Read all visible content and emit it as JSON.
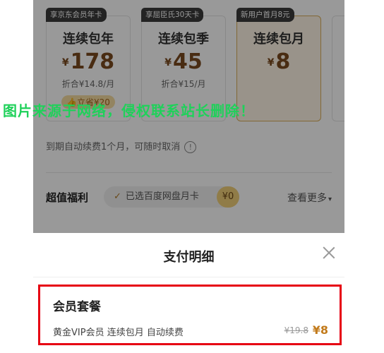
{
  "plans": [
    {
      "tag": "享京东会员年卡",
      "name": "连续包年",
      "currency": "¥",
      "price": "178",
      "per_month": "折合¥14.8/月",
      "save": "立省¥20",
      "selected": false
    },
    {
      "tag": "享屈臣氏30天卡",
      "name": "连续包季",
      "currency": "¥",
      "price": "45",
      "per_month": "折合¥15/月",
      "save": "",
      "selected": false
    },
    {
      "tag": "新用户首月8元",
      "name": "连续包月",
      "currency": "¥",
      "price": "8",
      "per_month": "",
      "save": "",
      "selected": true
    }
  ],
  "renew_note": "到期自动续费1个月，可随时取消",
  "info_icon": "!",
  "benefits": {
    "title": "超值福利",
    "chip_label": "已选百度网盘月卡",
    "chip_price": "¥0",
    "more_label": "查看更多"
  },
  "sheet": {
    "title": "支付明细",
    "package": {
      "title": "会员套餐",
      "desc": "黄金VIP会员 连续包月 自动续费",
      "original_price": "¥19.8",
      "price": "¥8"
    }
  },
  "watermark": "图片来源于网络，侵权联系站长删除！",
  "colors": {
    "accent": "#c27a1a",
    "highlight_border": "#e60012",
    "watermark": "#1fd15a"
  }
}
